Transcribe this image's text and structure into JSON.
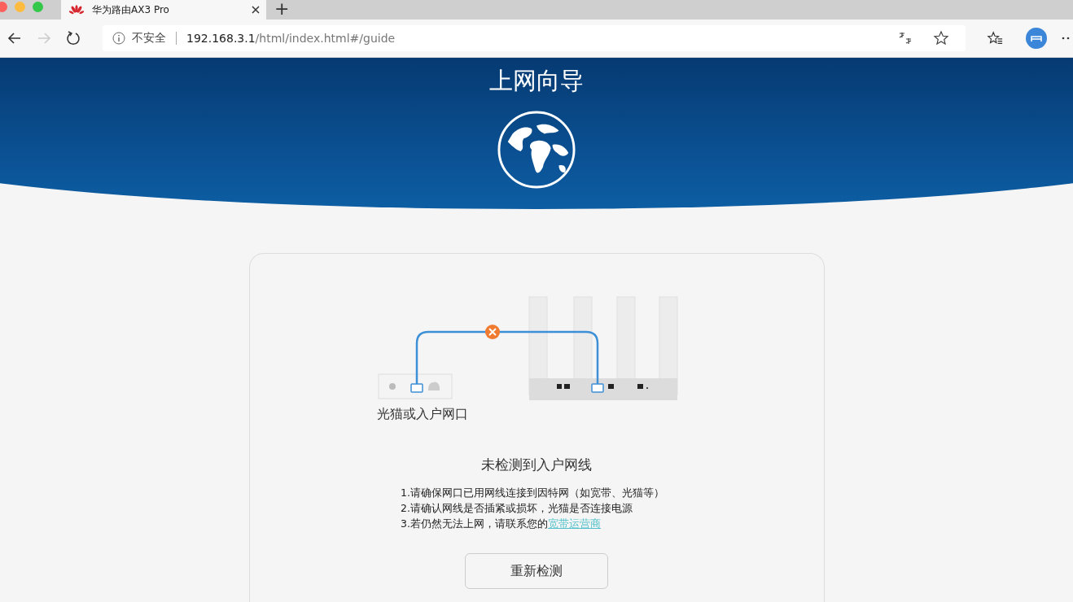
{
  "browser": {
    "tab": {
      "title": "华为路由AX3 Pro",
      "selected": true
    },
    "new_tab": "+",
    "security_label": "不安全",
    "url": "**192.168.3.1**/html/index.html#/guide"
  },
  "banner": {
    "title": "上网向导"
  },
  "diagram": {
    "port_label": "光猫或入户网口"
  },
  "status": {
    "heading": "未检测到入户网线",
    "tips": [
      "1.请确保网口已用网线连接到因特网（如宽带、光猫等）",
      "2.请确认网线是否插紧或损坏，光猫是否连接电源",
      "3.若仍然无法上网，请联系您的"
    ],
    "link": "宽带运营商"
  },
  "retry_button": "重新检测"
}
